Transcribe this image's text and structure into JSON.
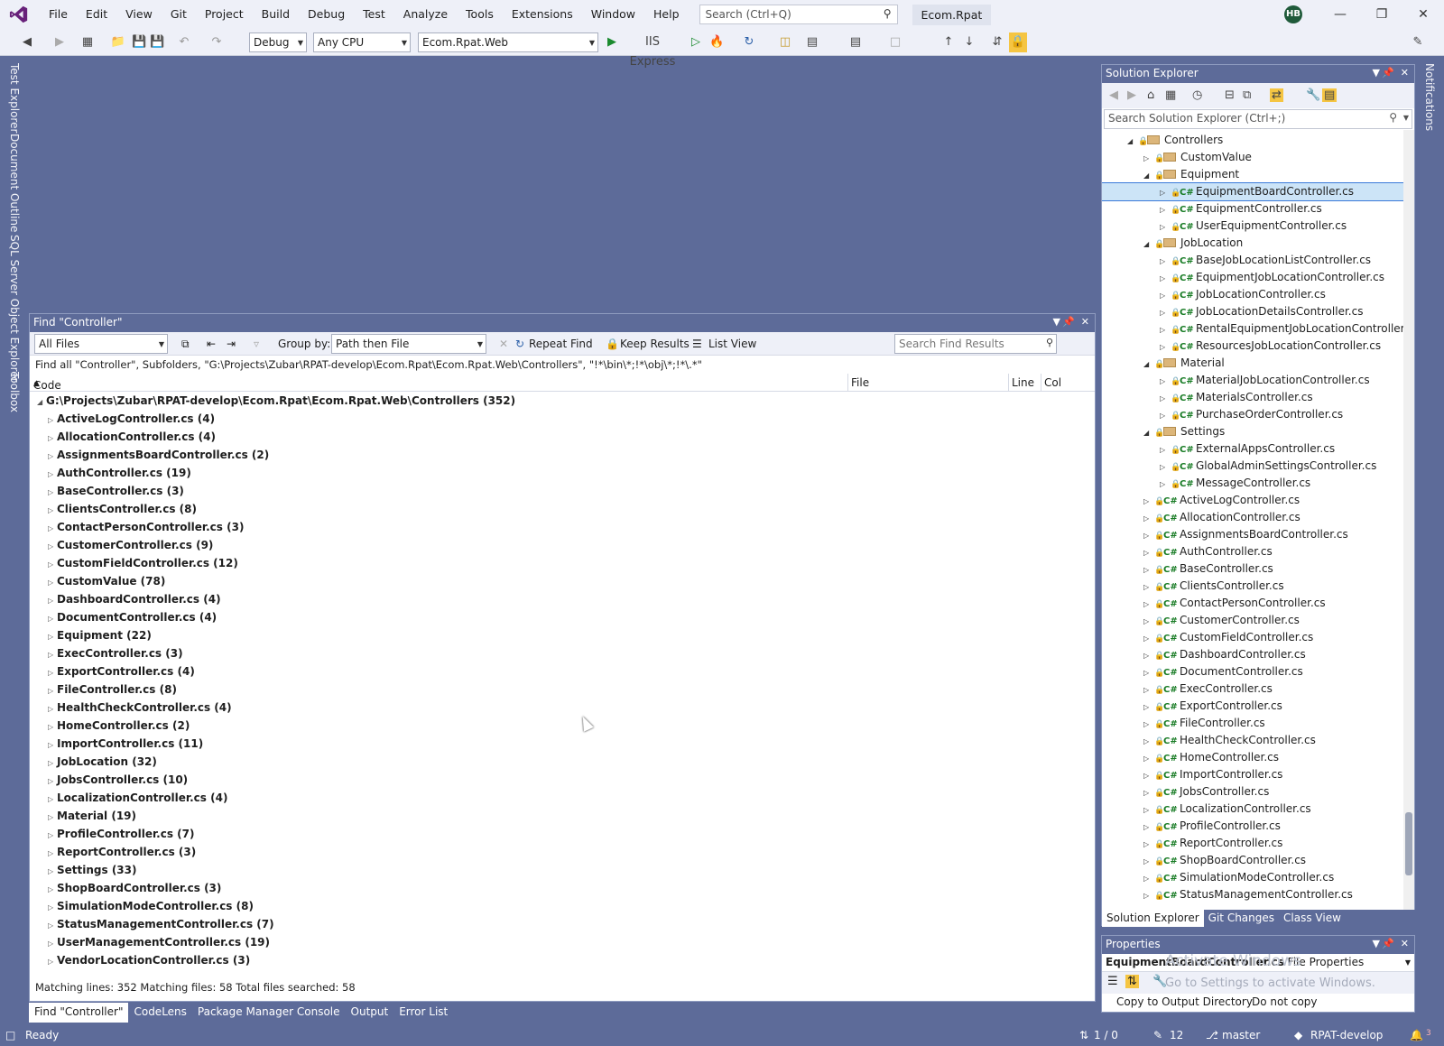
{
  "app": {
    "menu": [
      "File",
      "Edit",
      "View",
      "Git",
      "Project",
      "Build",
      "Debug",
      "Test",
      "Analyze",
      "Tools",
      "Extensions",
      "Window",
      "Help"
    ],
    "search_placeholder": "Search (Ctrl+Q)",
    "solution_title": "Ecom.Rpat",
    "user_initials": "HB"
  },
  "toolbar": {
    "config": "Debug",
    "platform": "Any CPU",
    "startup_project": "Ecom.Rpat.Web",
    "run_target": "IIS Express"
  },
  "left_tabs": [
    "Test Explorer",
    "Document Outline",
    "SQL Server Object Explorer",
    "Toolbox"
  ],
  "right_tabs": [
    "Notifications"
  ],
  "find": {
    "title": "Find \"Controller\"",
    "scope": "All Files",
    "group_by_label": "Group by:",
    "group_by_value": "Path then File",
    "repeat_find": "Repeat Find",
    "keep_results": "Keep Results",
    "list_view": "List View",
    "search_placeholder": "Search Find Results",
    "summary": "Find all \"Controller\", Subfolders, \"G:\\Projects\\Zubar\\RPAT-develop\\Ecom.Rpat\\Ecom.Rpat.Web\\Controllers\", \"!*\\bin\\*;!*\\obj\\*;!*\\.*\"",
    "columns": [
      "Code",
      "File",
      "Line",
      "Col"
    ],
    "root": "G:\\Projects\\Zubar\\RPAT-develop\\Ecom.Rpat\\Ecom.Rpat.Web\\Controllers (352)",
    "results": [
      "ActiveLogController.cs (4)",
      "AllocationController.cs (4)",
      "AssignmentsBoardController.cs (2)",
      "AuthController.cs (19)",
      "BaseController.cs (3)",
      "ClientsController.cs (8)",
      "ContactPersonController.cs (3)",
      "CustomerController.cs (9)",
      "CustomFieldController.cs (12)",
      "CustomValue (78)",
      "DashboardController.cs (4)",
      "DocumentController.cs (4)",
      "Equipment (22)",
      "ExecController.cs (3)",
      "ExportController.cs (4)",
      "FileController.cs (8)",
      "HealthCheckController.cs (4)",
      "HomeController.cs (2)",
      "ImportController.cs (11)",
      "JobLocation (32)",
      "JobsController.cs (10)",
      "LocalizationController.cs (4)",
      "Material (19)",
      "ProfileController.cs (7)",
      "ReportController.cs (3)",
      "Settings (33)",
      "ShopBoardController.cs (3)",
      "SimulationModeController.cs (8)",
      "StatusManagementController.cs (7)",
      "UserManagementController.cs (19)",
      "VendorLocationController.cs (3)"
    ],
    "status": "Matching lines: 352 Matching files: 58 Total files searched: 58"
  },
  "bottom_tabs": [
    "Find \"Controller\"",
    "CodeLens",
    "Package Manager Console",
    "Output",
    "Error List"
  ],
  "solution_explorer": {
    "title": "Solution Explorer",
    "search_placeholder": "Search Solution Explorer (Ctrl+;)",
    "tree": [
      {
        "label": "Controllers",
        "level": 0,
        "kind": "folder",
        "expanded": true
      },
      {
        "label": "CustomValue",
        "level": 1,
        "kind": "folder",
        "expanded": false
      },
      {
        "label": "Equipment",
        "level": 1,
        "kind": "folder",
        "expanded": true
      },
      {
        "label": "EquipmentBoardController.cs",
        "level": 2,
        "kind": "cs",
        "selected": true
      },
      {
        "label": "EquipmentController.cs",
        "level": 2,
        "kind": "cs"
      },
      {
        "label": "UserEquipmentController.cs",
        "level": 2,
        "kind": "cs"
      },
      {
        "label": "JobLocation",
        "level": 1,
        "kind": "folder",
        "expanded": true
      },
      {
        "label": "BaseJobLocationListController.cs",
        "level": 2,
        "kind": "cs"
      },
      {
        "label": "EquipmentJobLocationController.cs",
        "level": 2,
        "kind": "cs"
      },
      {
        "label": "JobLocationController.cs",
        "level": 2,
        "kind": "cs"
      },
      {
        "label": "JobLocationDetailsController.cs",
        "level": 2,
        "kind": "cs"
      },
      {
        "label": "RentalEquipmentJobLocationController.cs",
        "level": 2,
        "kind": "cs"
      },
      {
        "label": "ResourcesJobLocationController.cs",
        "level": 2,
        "kind": "cs"
      },
      {
        "label": "Material",
        "level": 1,
        "kind": "folder",
        "expanded": true
      },
      {
        "label": "MaterialJobLocationController.cs",
        "level": 2,
        "kind": "cs"
      },
      {
        "label": "MaterialsController.cs",
        "level": 2,
        "kind": "cs"
      },
      {
        "label": "PurchaseOrderController.cs",
        "level": 2,
        "kind": "cs"
      },
      {
        "label": "Settings",
        "level": 1,
        "kind": "folder",
        "expanded": true
      },
      {
        "label": "ExternalAppsController.cs",
        "level": 2,
        "kind": "cs"
      },
      {
        "label": "GlobalAdminSettingsController.cs",
        "level": 2,
        "kind": "cs"
      },
      {
        "label": "MessageController.cs",
        "level": 2,
        "kind": "cs"
      },
      {
        "label": "ActiveLogController.cs",
        "level": 1,
        "kind": "cs"
      },
      {
        "label": "AllocationController.cs",
        "level": 1,
        "kind": "cs"
      },
      {
        "label": "AssignmentsBoardController.cs",
        "level": 1,
        "kind": "cs"
      },
      {
        "label": "AuthController.cs",
        "level": 1,
        "kind": "cs"
      },
      {
        "label": "BaseController.cs",
        "level": 1,
        "kind": "cs"
      },
      {
        "label": "ClientsController.cs",
        "level": 1,
        "kind": "cs"
      },
      {
        "label": "ContactPersonController.cs",
        "level": 1,
        "kind": "cs"
      },
      {
        "label": "CustomerController.cs",
        "level": 1,
        "kind": "cs"
      },
      {
        "label": "CustomFieldController.cs",
        "level": 1,
        "kind": "cs"
      },
      {
        "label": "DashboardController.cs",
        "level": 1,
        "kind": "cs"
      },
      {
        "label": "DocumentController.cs",
        "level": 1,
        "kind": "cs"
      },
      {
        "label": "ExecController.cs",
        "level": 1,
        "kind": "cs"
      },
      {
        "label": "ExportController.cs",
        "level": 1,
        "kind": "cs"
      },
      {
        "label": "FileController.cs",
        "level": 1,
        "kind": "cs"
      },
      {
        "label": "HealthCheckController.cs",
        "level": 1,
        "kind": "cs"
      },
      {
        "label": "HomeController.cs",
        "level": 1,
        "kind": "cs"
      },
      {
        "label": "ImportController.cs",
        "level": 1,
        "kind": "cs"
      },
      {
        "label": "JobsController.cs",
        "level": 1,
        "kind": "cs"
      },
      {
        "label": "LocalizationController.cs",
        "level": 1,
        "kind": "cs"
      },
      {
        "label": "ProfileController.cs",
        "level": 1,
        "kind": "cs"
      },
      {
        "label": "ReportController.cs",
        "level": 1,
        "kind": "cs"
      },
      {
        "label": "ShopBoardController.cs",
        "level": 1,
        "kind": "cs"
      },
      {
        "label": "SimulationModeController.cs",
        "level": 1,
        "kind": "cs"
      },
      {
        "label": "StatusManagementController.cs",
        "level": 1,
        "kind": "cs"
      }
    ],
    "tabs": [
      "Solution Explorer",
      "Git Changes",
      "Class View"
    ]
  },
  "properties": {
    "title": "Properties",
    "object_name": "EquipmentBoardController.cs",
    "object_type": "File Properties",
    "watermark_1": "Activate Windows",
    "watermark_2": "Go to Settings to activate Windows.",
    "row_name": "Copy to Output Directory",
    "row_value": "Do not copy"
  },
  "status": {
    "ready": "Ready",
    "position": "1 / 0",
    "edits": "12",
    "branch": "master",
    "repo": "RPAT-develop",
    "notifications": "3"
  }
}
